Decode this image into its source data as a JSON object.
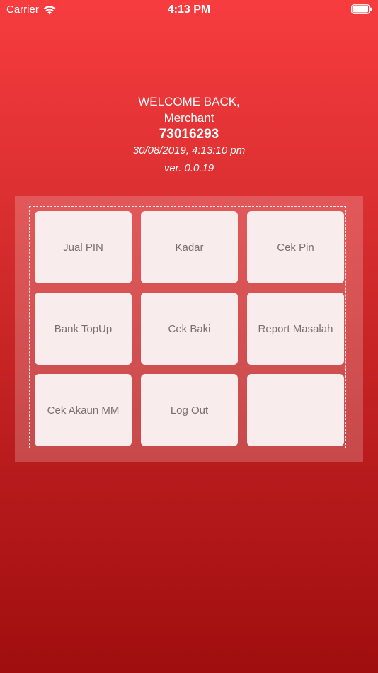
{
  "status_bar": {
    "carrier": "Carrier",
    "time": "4:13 PM"
  },
  "welcome": {
    "title": "WELCOME BACK,",
    "name": "Merchant",
    "id": "73016293",
    "datetime": "30/08/2019, 4:13:10 pm",
    "version": "ver. 0.0.19"
  },
  "menu": {
    "items": [
      {
        "label": "Jual PIN"
      },
      {
        "label": "Kadar"
      },
      {
        "label": "Cek Pin"
      },
      {
        "label": "Bank TopUp"
      },
      {
        "label": "Cek Baki"
      },
      {
        "label": "Report Masalah"
      },
      {
        "label": "Cek Akaun MM"
      },
      {
        "label": "Log Out"
      },
      {
        "label": ""
      }
    ]
  },
  "colors": {
    "background_top": "#f73c3e",
    "background_bottom": "#a00e0f",
    "tile": "#f9ecec",
    "tile_text": "#7a6f6f"
  }
}
